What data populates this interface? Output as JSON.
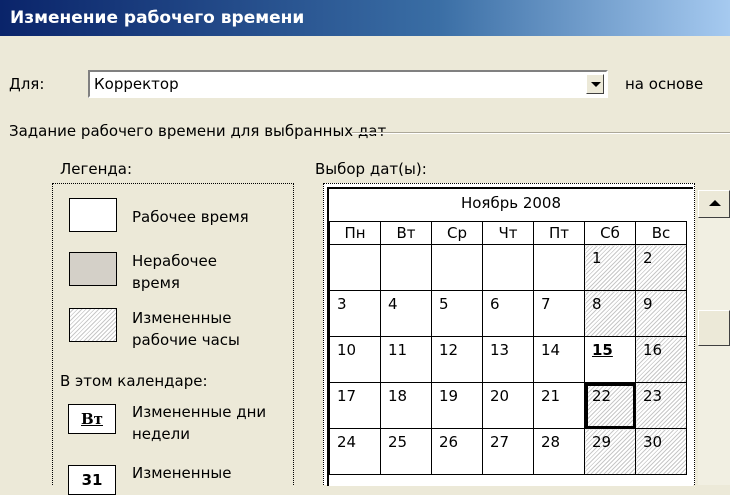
{
  "window": {
    "title": "Изменение рабочего времени"
  },
  "for_field": {
    "label": "Для:",
    "value": "Корректор",
    "basis_label": "на основе"
  },
  "group": {
    "title": "Задание рабочего времени для выбранных дат"
  },
  "legend": {
    "title": "Легенда:",
    "working": "Рабочее время",
    "nonworking": "Нерабочее время",
    "changed_hours": "Измененные рабочие часы",
    "in_calendar": "В этом календаре:",
    "changed_days_icon": "Вт",
    "changed_days": "Измененные дни недели",
    "changed_dates_icon": "31",
    "changed_dates": "Измененные"
  },
  "calendar": {
    "title": "Выбор дат(ы):",
    "month": "Ноябрь 2008",
    "weekdays": [
      "Пн",
      "Вт",
      "Ср",
      "Чт",
      "Пт",
      "Сб",
      "Вс"
    ],
    "weeks": [
      [
        "",
        "",
        "",
        "",
        "",
        "1",
        "2"
      ],
      [
        "3",
        "4",
        "5",
        "6",
        "7",
        "8",
        "9"
      ],
      [
        "10",
        "11",
        "12",
        "13",
        "14",
        "15",
        "16"
      ],
      [
        "17",
        "18",
        "19",
        "20",
        "21",
        "22",
        "23"
      ],
      [
        "24",
        "25",
        "26",
        "27",
        "28",
        "29",
        "30"
      ],
      [
        "",
        "",
        "",
        "",
        "",
        "",
        ""
      ]
    ],
    "today": "15",
    "selected": "22"
  },
  "icons": {
    "dropdown": "chevron-down-icon",
    "scroll_up": "arrow-up-icon"
  },
  "colors": {
    "titlebar": "#0a246a",
    "dialog_bg": "#ece9d8",
    "nonworking": "#d4d0c8"
  }
}
